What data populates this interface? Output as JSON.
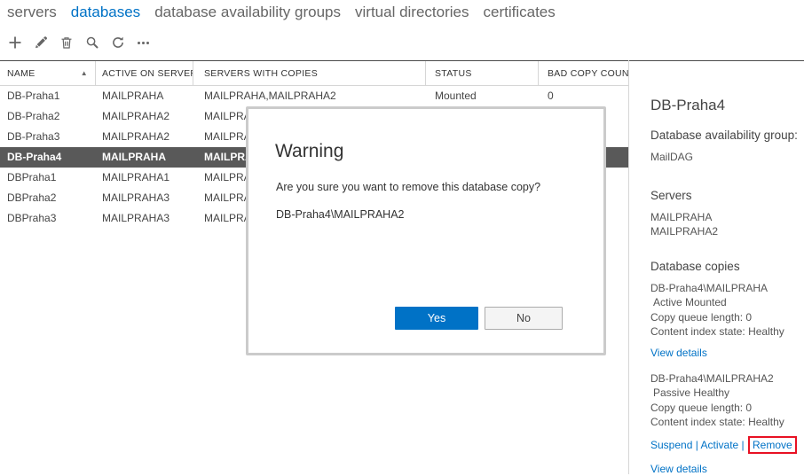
{
  "nav": {
    "tabs": [
      {
        "label": "servers",
        "active": false
      },
      {
        "label": "databases",
        "active": true
      },
      {
        "label": "database availability groups",
        "active": false
      },
      {
        "label": "virtual directories",
        "active": false
      },
      {
        "label": "certificates",
        "active": false
      }
    ]
  },
  "toolbar": {
    "icons": [
      "add-icon",
      "edit-icon",
      "delete-icon",
      "search-icon",
      "refresh-icon",
      "more-icon"
    ]
  },
  "table": {
    "columns": {
      "name": "NAME",
      "active_on_server": "ACTIVE ON SERVER",
      "servers_with_copies": "SERVERS WITH COPIES",
      "status": "STATUS",
      "bad_copy_count": "BAD COPY COUNT"
    },
    "sort_icon": "▲",
    "rows": [
      {
        "name": "DB-Praha1",
        "active_on": "MAILPRAHA",
        "copies": "MAILPRAHA,MAILPRAHA2",
        "status": "Mounted",
        "bad": "0",
        "selected": false
      },
      {
        "name": "DB-Praha2",
        "active_on": "MAILPRAHA2",
        "copies": "MAILPRA",
        "status": "",
        "bad": "",
        "selected": false
      },
      {
        "name": "DB-Praha3",
        "active_on": "MAILPRAHA2",
        "copies": "MAILPRA",
        "status": "",
        "bad": "",
        "selected": false
      },
      {
        "name": "DB-Praha4",
        "active_on": "MAILPRAHA",
        "copies": "MAILPRA",
        "status": "",
        "bad": "",
        "selected": true
      },
      {
        "name": "DBPraha1",
        "active_on": "MAILPRAHA1",
        "copies": "MAILPRA",
        "status": "",
        "bad": "",
        "selected": false
      },
      {
        "name": "DBPraha2",
        "active_on": "MAILPRAHA3",
        "copies": "MAILPRA",
        "status": "",
        "bad": "",
        "selected": false
      },
      {
        "name": "DBPraha3",
        "active_on": "MAILPRAHA3",
        "copies": "MAILPRA",
        "status": "",
        "bad": "",
        "selected": false
      }
    ]
  },
  "dialog": {
    "title": "Warning",
    "message": "Are you sure you want to remove this database copy?",
    "target": "DB-Praha4\\MAILPRAHA2",
    "yes_label": "Yes",
    "no_label": "No"
  },
  "details": {
    "title": "DB-Praha4",
    "dag_label": "Database availability group:",
    "dag_value": "MailDAG",
    "servers_heading": "Servers",
    "servers": [
      "MAILPRAHA",
      "MAILPRAHA2"
    ],
    "copies_heading": "Database copies",
    "copies": [
      {
        "name": "DB-Praha4\\MAILPRAHA",
        "state": "Active Mounted",
        "copy_queue": "Copy queue length: 0",
        "content_index": "Content index state: Healthy",
        "view_details": "View details"
      },
      {
        "name": "DB-Praha4\\MAILPRAHA2",
        "state": "Passive Healthy",
        "copy_queue": "Copy queue length: 0",
        "content_index": "Content index state: Healthy",
        "actions": [
          "Suspend",
          "Activate",
          "Remove"
        ],
        "separator": "|",
        "view_details": "View details"
      }
    ]
  },
  "colors": {
    "accent_blue": "#0072c6",
    "selected_row_bg": "#595959",
    "highlight_red": "#e81123"
  }
}
